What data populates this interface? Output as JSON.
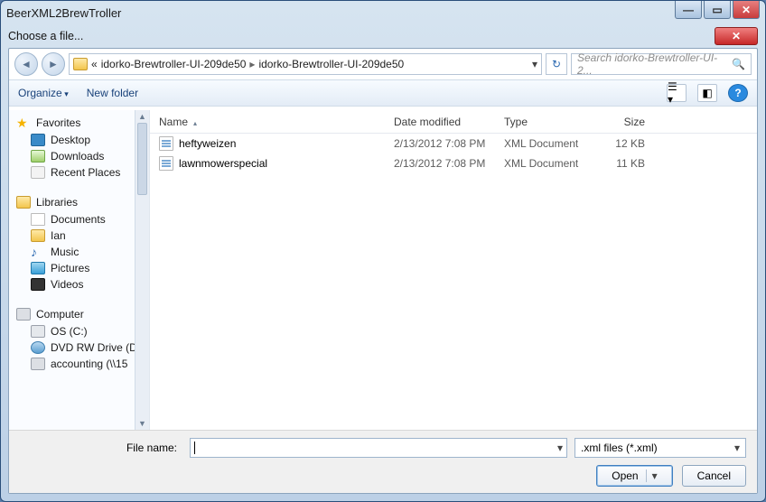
{
  "outer": {
    "title": "BeerXML2BrewTroller"
  },
  "win_controls": {
    "min": "—",
    "max": "▭",
    "close": "✕"
  },
  "dialog": {
    "title": "Choose a file...",
    "close": "✕"
  },
  "breadcrumb": {
    "overflow": "«",
    "segments": [
      "idorko-Brewtroller-UI-209de50",
      "idorko-Brewtroller-UI-209de50"
    ]
  },
  "search": {
    "placeholder": "Search idorko-Brewtroller-UI-2..."
  },
  "toolbar": {
    "organize": "Organize",
    "new_folder": "New folder",
    "help": "?"
  },
  "nav": {
    "groups": [
      {
        "title": "Favorites",
        "icon": "star",
        "items": [
          {
            "label": "Desktop",
            "icon": "desk"
          },
          {
            "label": "Downloads",
            "icon": "dl"
          },
          {
            "label": "Recent Places",
            "icon": "rec"
          }
        ]
      },
      {
        "title": "Libraries",
        "icon": "lib",
        "items": [
          {
            "label": "Documents",
            "icon": "doc"
          },
          {
            "label": "Ian",
            "icon": "user"
          },
          {
            "label": "Music",
            "icon": "mus"
          },
          {
            "label": "Pictures",
            "icon": "pic"
          },
          {
            "label": "Videos",
            "icon": "vid"
          }
        ]
      },
      {
        "title": "Computer",
        "icon": "comp",
        "items": [
          {
            "label": "OS (C:)",
            "icon": "drv"
          },
          {
            "label": "DVD RW Drive (D",
            "icon": "dvd"
          },
          {
            "label": "accounting (\\\\15",
            "icon": "net"
          }
        ]
      }
    ]
  },
  "columns": {
    "name": "Name",
    "date": "Date modified",
    "type": "Type",
    "size": "Size"
  },
  "files": [
    {
      "name": "heftyweizen",
      "date": "2/13/2012 7:08 PM",
      "type": "XML Document",
      "size": "12 KB"
    },
    {
      "name": "lawnmowerspecial",
      "date": "2/13/2012 7:08 PM",
      "type": "XML Document",
      "size": "11 KB"
    }
  ],
  "footer": {
    "filename_label": "File name:",
    "filter": ".xml files (*.xml)",
    "open": "Open",
    "cancel": "Cancel"
  }
}
